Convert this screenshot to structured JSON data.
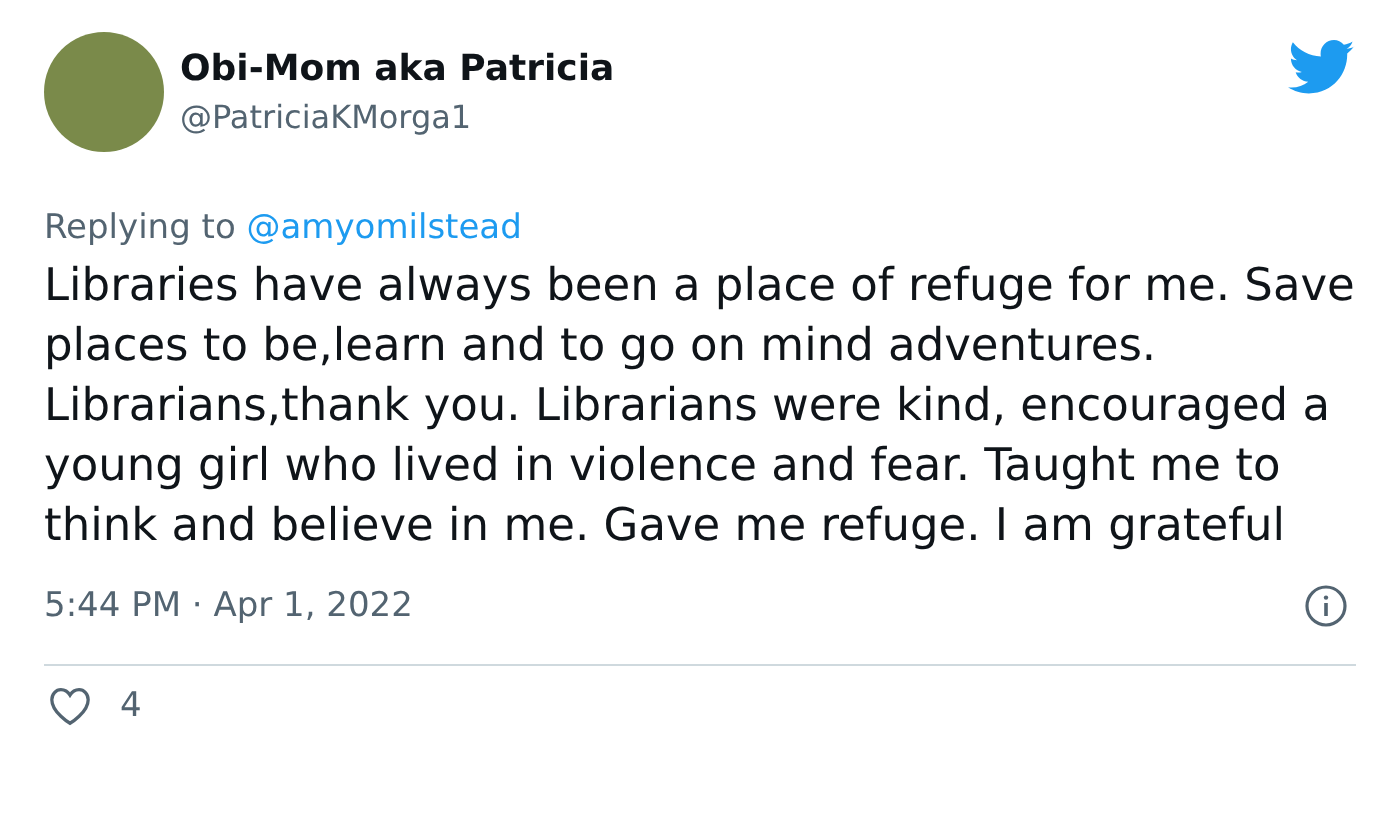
{
  "tweet": {
    "author_name": "Obi-Mom aka Patricia",
    "handle": "@PatriciaKMorga1",
    "reply_label": "Replying to",
    "reply_mention": "@amyomilstead",
    "body": "Libraries have always been a place of refuge for me. Save places to be,learn and to go on mind adventures. Librarians,thank you. Librarians were kind, encouraged a young girl who lived in violence and fear. Taught me to think and believe in me. Gave me refuge. I am grateful",
    "timestamp": "5:44 PM · Apr 1, 2022",
    "likes": "4"
  }
}
